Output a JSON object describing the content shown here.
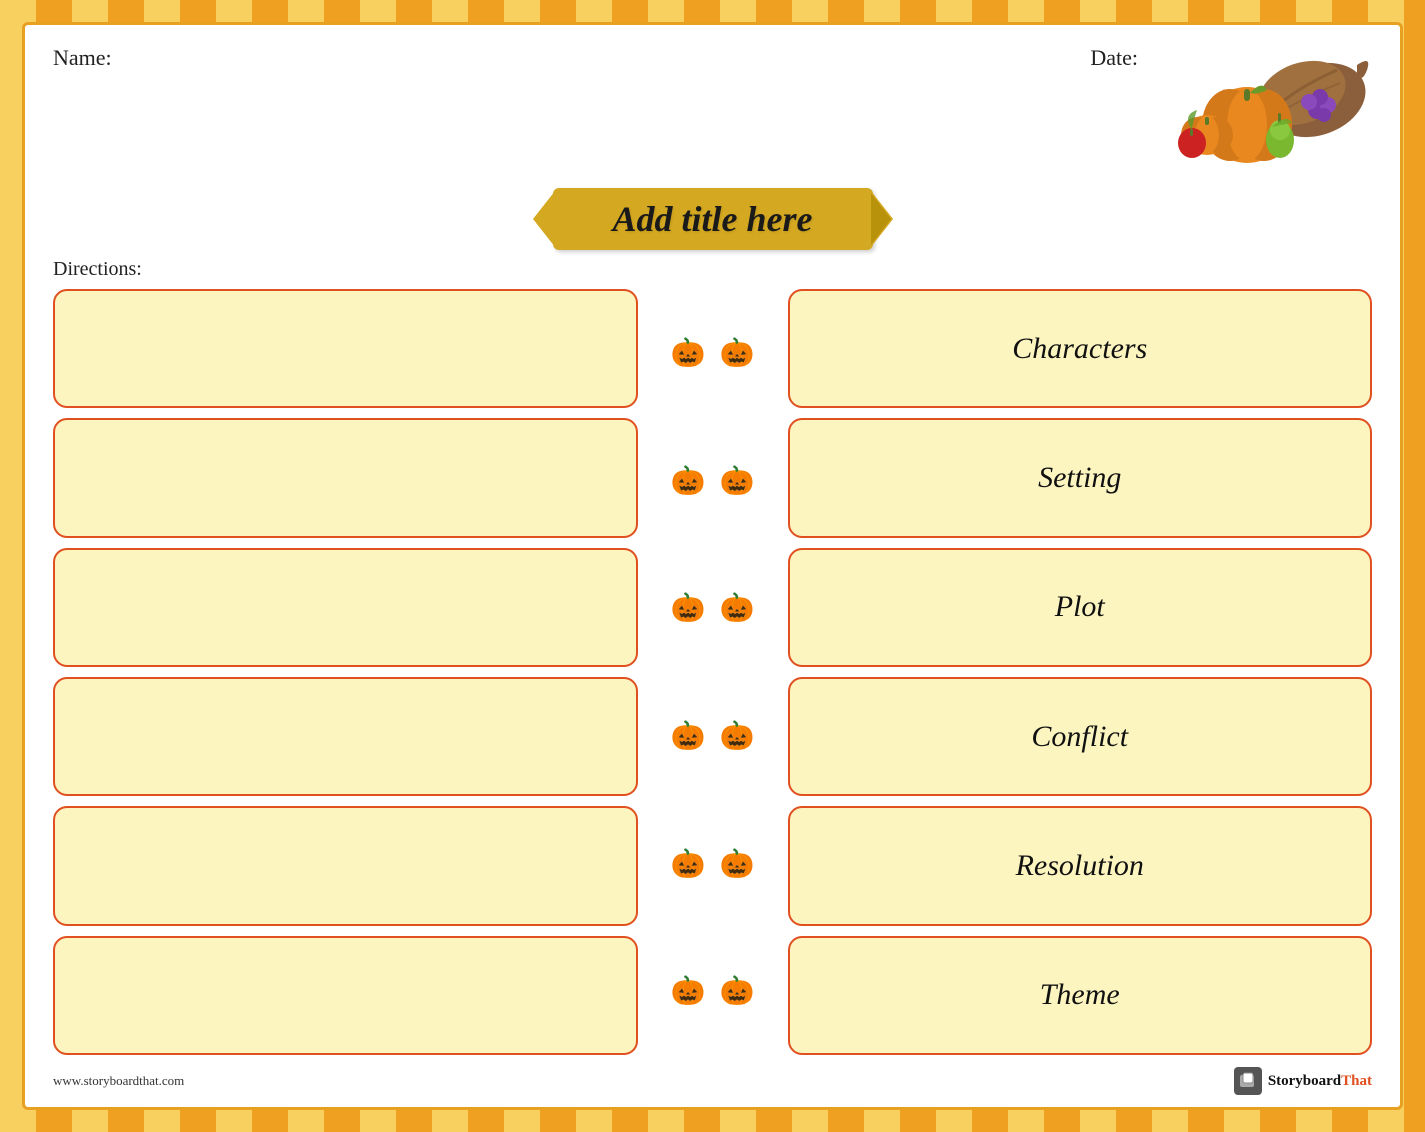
{
  "page": {
    "background_color": "#f0a830",
    "border_color": "#e8a020"
  },
  "header": {
    "name_label": "Name:",
    "date_label": "Date:"
  },
  "title": {
    "text": "Add title here"
  },
  "directions": {
    "label": "Directions:"
  },
  "rows": [
    {
      "id": 1,
      "label": "Characters"
    },
    {
      "id": 2,
      "label": "Setting"
    },
    {
      "id": 3,
      "label": "Plot"
    },
    {
      "id": 4,
      "label": "Conflict"
    },
    {
      "id": 5,
      "label": "Resolution"
    },
    {
      "id": 6,
      "label": "Theme"
    }
  ],
  "footer": {
    "url": "www.storyboardthat.com",
    "brand": "StoryboardThat"
  },
  "pumpkin_emoji": "🎃"
}
